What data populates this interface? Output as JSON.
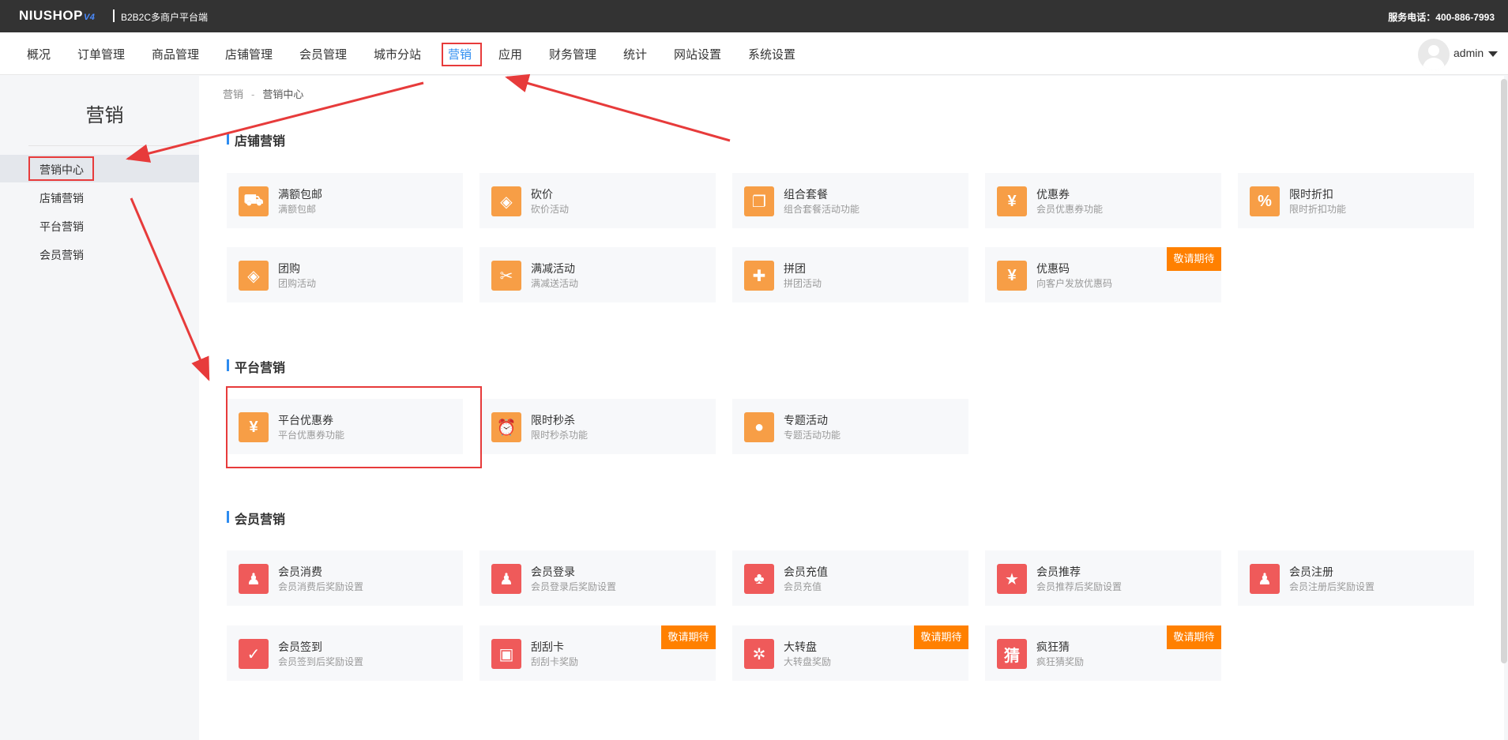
{
  "header": {
    "logo": "NIUSHOP",
    "logo_version": "V4",
    "tagline": "B2B2C多商户平台端",
    "hotline": "服务电话：400-886-7993"
  },
  "nav": {
    "items": [
      "概况",
      "订单管理",
      "商品管理",
      "店铺管理",
      "会员管理",
      "城市分站",
      "营销",
      "应用",
      "财务管理",
      "统计",
      "网站设置",
      "系统设置"
    ],
    "active": "营销",
    "user": "admin"
  },
  "sidebar": {
    "title": "营销",
    "items": [
      "营销中心",
      "店铺营销",
      "平台营销",
      "会员营销"
    ],
    "active": "营销中心"
  },
  "breadcrumb": {
    "root": "营销",
    "sep": "-",
    "current": "营销中心"
  },
  "sections": {
    "store": {
      "title": "店铺营销",
      "cards": [
        {
          "title": "满额包邮",
          "desc": "满额包邮",
          "icon": "truck-icon",
          "symbol": "⛟"
        },
        {
          "title": "砍价",
          "desc": "砍价活动",
          "icon": "tag-icon",
          "symbol": "◈"
        },
        {
          "title": "组合套餐",
          "desc": "组合套餐活动功能",
          "icon": "combo-icon",
          "symbol": "❐"
        },
        {
          "title": "优惠券",
          "desc": "会员优惠券功能",
          "icon": "coupon-icon",
          "symbol": "¥"
        },
        {
          "title": "限时折扣",
          "desc": "限时折扣功能",
          "icon": "discount-icon",
          "symbol": "%"
        },
        {
          "title": "团购",
          "desc": "团购活动",
          "icon": "group-tag-icon",
          "symbol": "◈"
        },
        {
          "title": "满减活动",
          "desc": "满减送活动",
          "icon": "ticket-icon",
          "symbol": "✂"
        },
        {
          "title": "拼团",
          "desc": "拼团活动",
          "icon": "puzzle-icon",
          "symbol": "✚"
        },
        {
          "title": "优惠码",
          "desc": "向客户发放优惠码",
          "icon": "code-coupon-icon",
          "symbol": "¥",
          "badge": "敬请期待"
        }
      ]
    },
    "platform": {
      "title": "平台营销",
      "cards": [
        {
          "title": "平台优惠券",
          "desc": "平台优惠券功能",
          "icon": "coupon-icon",
          "symbol": "¥"
        },
        {
          "title": "限时秒杀",
          "desc": "限时秒杀功能",
          "icon": "alarm-clock-icon",
          "symbol": "⏰"
        },
        {
          "title": "专题活动",
          "desc": "专题活动功能",
          "icon": "bulb-icon",
          "symbol": "●"
        }
      ]
    },
    "member": {
      "title": "会员营销",
      "cards": [
        {
          "title": "会员消费",
          "desc": "会员消费后奖励设置",
          "icon": "user-spend-icon",
          "symbol": "♟"
        },
        {
          "title": "会员登录",
          "desc": "会员登录后奖励设置",
          "icon": "user-login-icon",
          "symbol": "♟"
        },
        {
          "title": "会员充值",
          "desc": "会员充值",
          "icon": "recharge-icon",
          "symbol": "♣"
        },
        {
          "title": "会员推荐",
          "desc": "会员推荐后奖励设置",
          "icon": "star-icon",
          "symbol": "★"
        },
        {
          "title": "会员注册",
          "desc": "会员注册后奖励设置",
          "icon": "user-add-icon",
          "symbol": "♟"
        },
        {
          "title": "会员签到",
          "desc": "会员签到后奖励设置",
          "icon": "calendar-check-icon",
          "symbol": "✓"
        },
        {
          "title": "刮刮卡",
          "desc": "刮刮卡奖励",
          "icon": "scratch-card-icon",
          "symbol": "▣",
          "badge": "敬请期待"
        },
        {
          "title": "大转盘",
          "desc": "大转盘奖励",
          "icon": "wheel-icon",
          "symbol": "✲",
          "badge": "敬请期待"
        },
        {
          "title": "疯狂猜",
          "desc": "疯狂猜奖励",
          "icon": "guess-icon",
          "symbol": "猜",
          "badge": "敬请期待"
        }
      ]
    }
  },
  "colors": {
    "accent": "#2d8cf0",
    "icon_orange": "#f79e46",
    "icon_red": "#ef5a5a",
    "badge": "#ff8000",
    "annotation": "#e73b3b"
  }
}
